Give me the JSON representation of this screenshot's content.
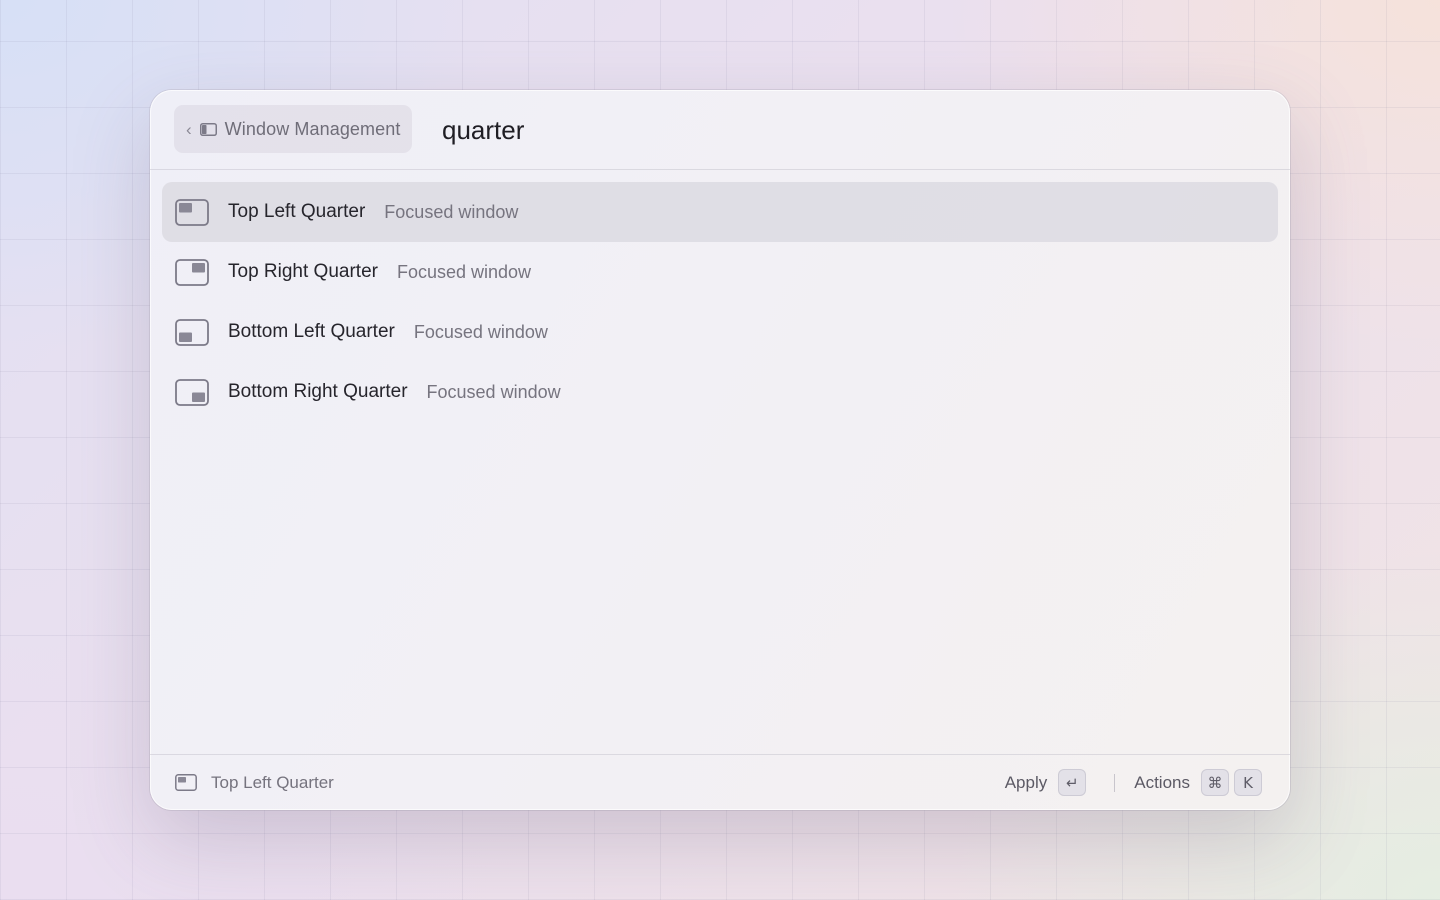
{
  "breadcrumb": {
    "chevron": "‹",
    "icon": "sidebar-icon",
    "label": "Window Management"
  },
  "search": {
    "value": "quarter",
    "placeholder": ""
  },
  "results": [
    {
      "title": "Top Left Quarter",
      "subtitle": "Focused window",
      "icon": "top-left-quarter-icon",
      "selected": true
    },
    {
      "title": "Top Right Quarter",
      "subtitle": "Focused window",
      "icon": "top-right-quarter-icon",
      "selected": false
    },
    {
      "title": "Bottom Left Quarter",
      "subtitle": "Focused window",
      "icon": "bottom-left-quarter-icon",
      "selected": false
    },
    {
      "title": "Bottom Right Quarter",
      "subtitle": "Focused window",
      "icon": "bottom-right-quarter-icon",
      "selected": false
    }
  ],
  "footer": {
    "selected_title": "Top Left Quarter",
    "selected_icon": "top-left-quarter-icon",
    "apply_label": "Apply",
    "apply_key": "↵",
    "actions_label": "Actions",
    "actions_keys": [
      "⌘",
      "K"
    ]
  },
  "colors": {
    "icon_stroke": "#7c7a88",
    "icon_fill": "#8a8896",
    "selection_bg": "#dcdae2"
  }
}
